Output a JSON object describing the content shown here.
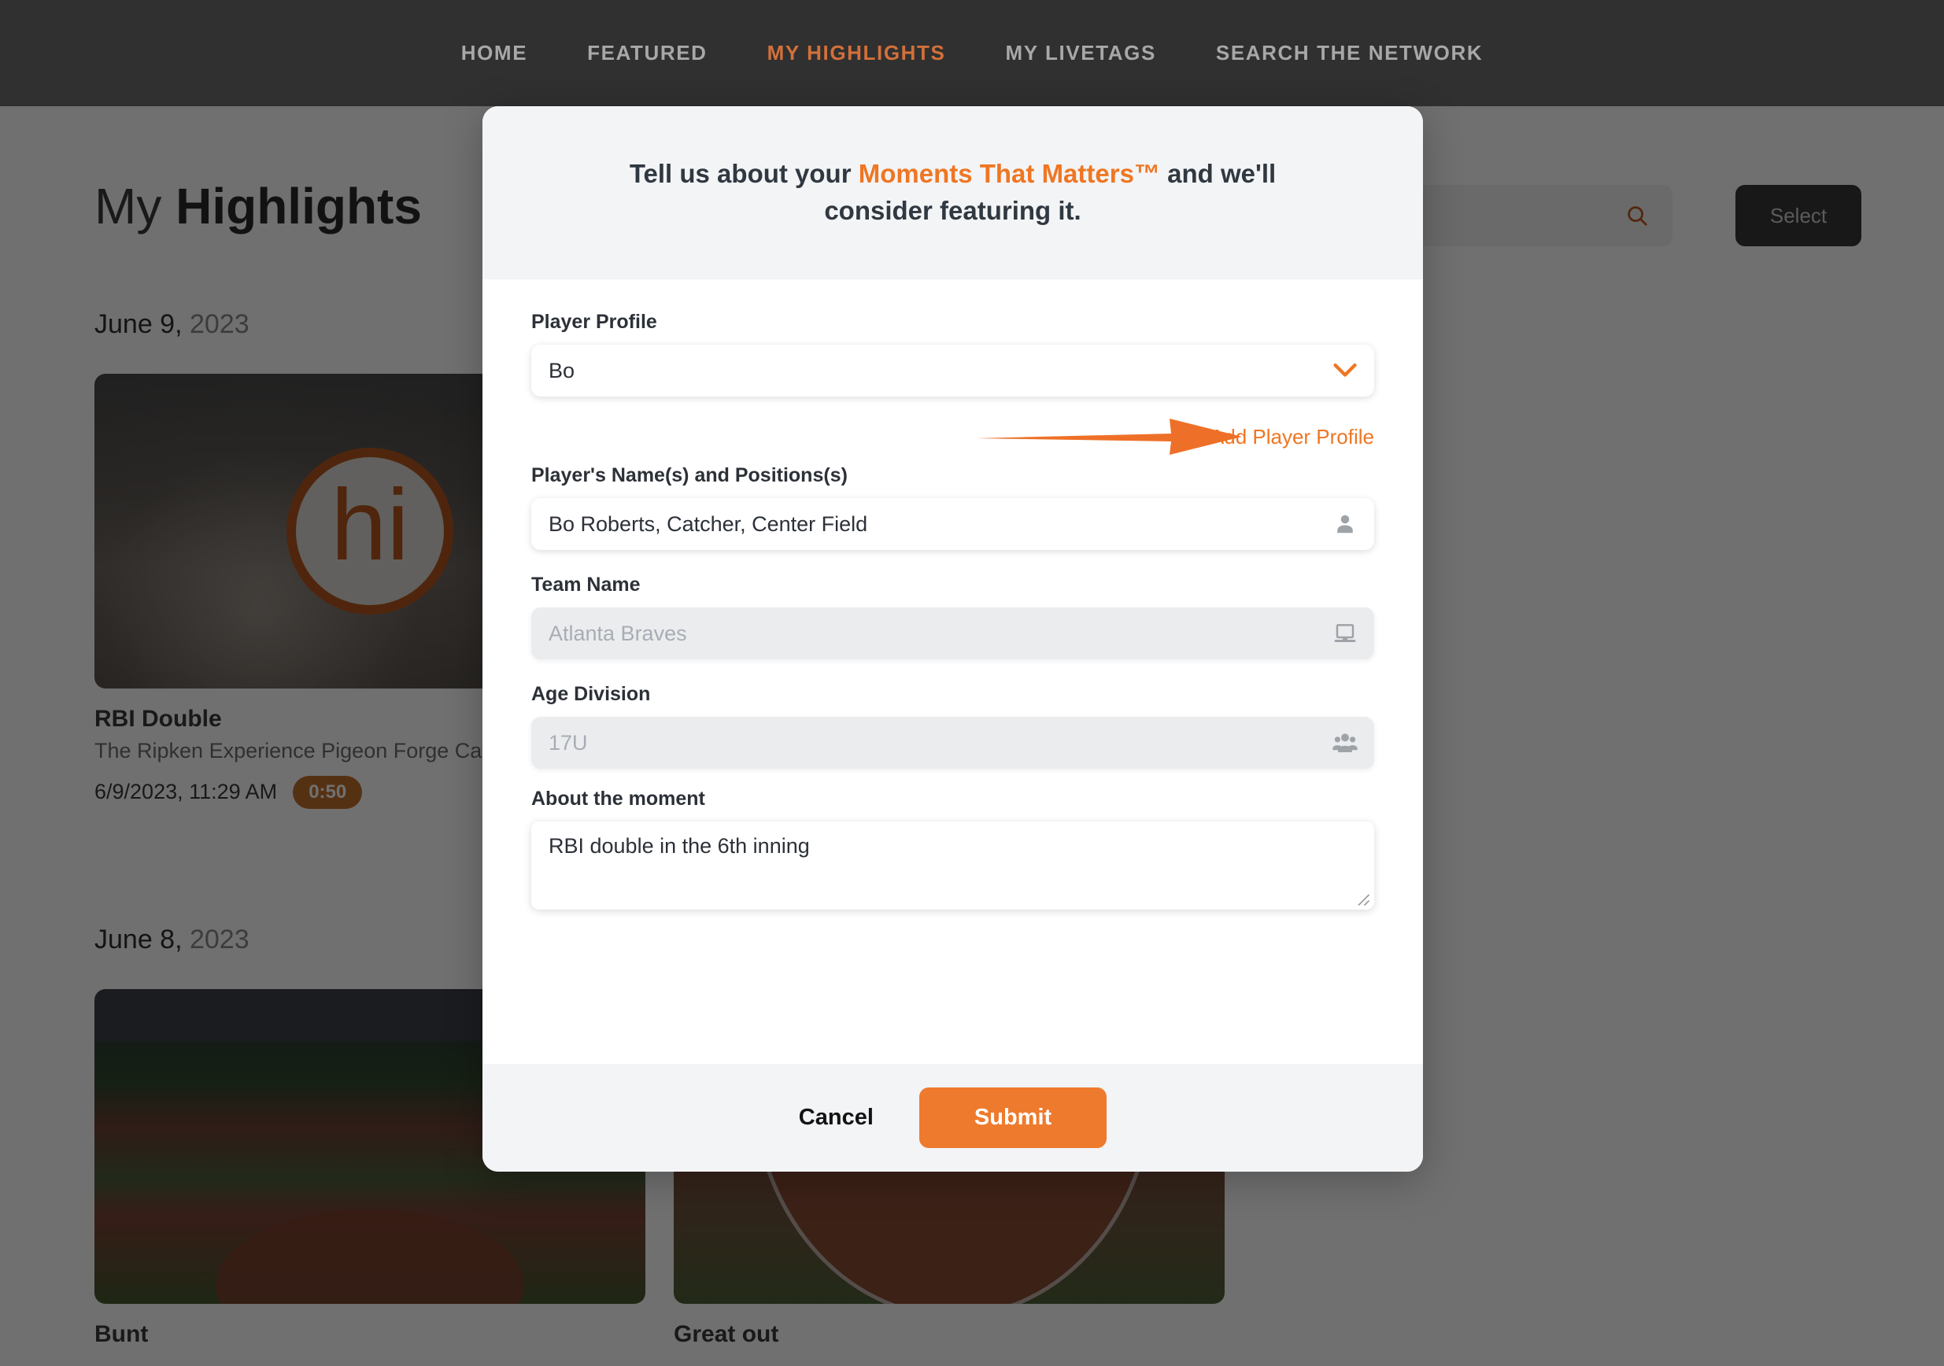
{
  "nav": {
    "items": [
      {
        "label": "HOME",
        "active": false
      },
      {
        "label": "FEATURED",
        "active": false
      },
      {
        "label": "MY HIGHLIGHTS",
        "active": true
      },
      {
        "label": "MY LIVETAGS",
        "active": false
      },
      {
        "label": "SEARCH THE NETWORK",
        "active": false
      }
    ]
  },
  "page": {
    "title_light": "My",
    "title_bold": "Highlights",
    "search_placeholder": "",
    "search_icon": "search-icon",
    "select_label": "Select",
    "sections": [
      {
        "date_month_day": "June 9,",
        "date_year": "2023",
        "cards": [
          {
            "title": "RBI Double",
            "subtitle": "The Ripken Experience Pigeon Forge Camden Yards",
            "timestamp": "6/9/2023, 11:29 AM",
            "duration": "0:50",
            "logo_text": "hi"
          }
        ]
      },
      {
        "date_month_day": "June 8,",
        "date_year": "2023",
        "cards": [
          {
            "title": "Bunt"
          },
          {
            "title": "Great out"
          }
        ]
      }
    ]
  },
  "modal": {
    "header": {
      "text_before": "Tell us about your ",
      "accent": "Moments That Matters™",
      "text_after": " and we'll consider featuring it."
    },
    "fields": {
      "player_profile": {
        "label": "Player Profile",
        "value": "Bo",
        "icon": "chevron-down-icon"
      },
      "add_player_profile": {
        "link_label": "Add Player Profile",
        "arrow_icon": "arrow-right-icon"
      },
      "player_names": {
        "label": "Player's Name(s) and Positions(s)",
        "value": "Bo Roberts, Catcher, Center Field",
        "icon": "person-icon"
      },
      "team_name": {
        "label": "Team Name",
        "placeholder": "Atlanta Braves",
        "icon": "monitor-icon",
        "disabled": true
      },
      "age_division": {
        "label": "Age Division",
        "placeholder": "17U",
        "icon": "people-group-icon",
        "disabled": true
      },
      "about_moment": {
        "label": "About the moment",
        "value": "RBI double in the 6th inning"
      }
    },
    "footer": {
      "cancel_label": "Cancel",
      "submit_label": "Submit"
    }
  },
  "colors": {
    "accent_orange": "#ef7622",
    "submit_orange": "#ee7a2d",
    "nav_bg": "#303030",
    "modal_panel": "#f3f4f6",
    "badge_brown": "#c2702f"
  }
}
